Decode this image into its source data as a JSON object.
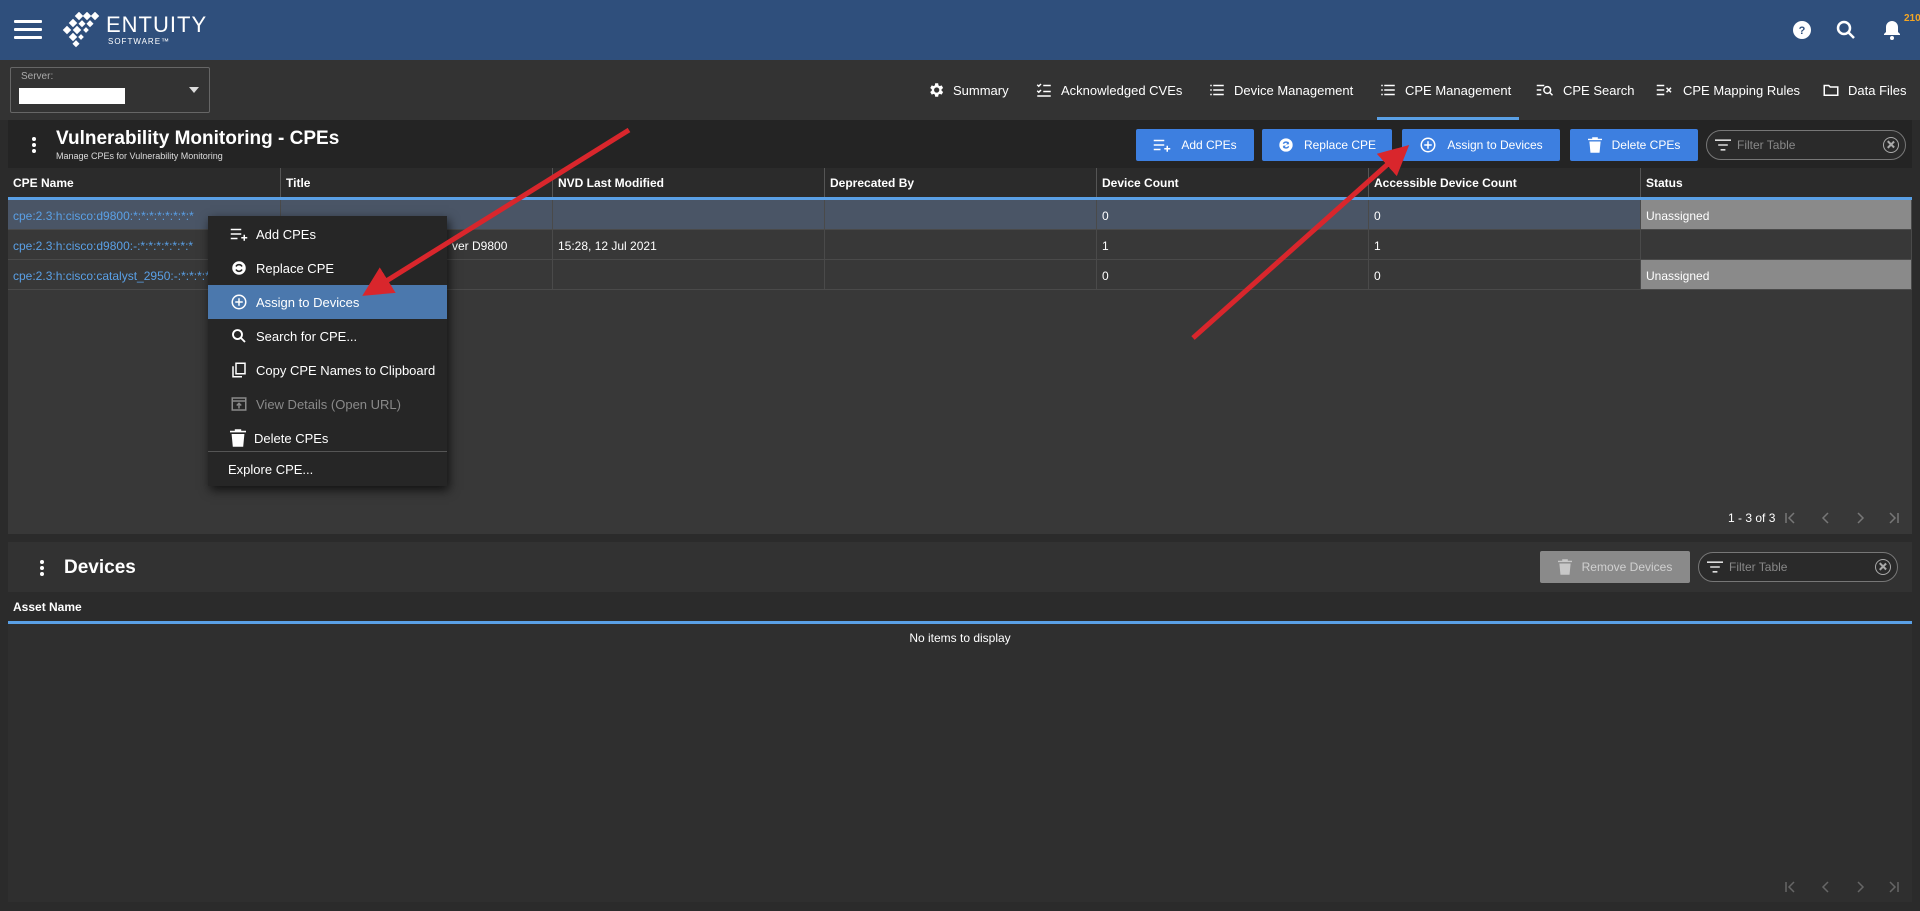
{
  "header": {
    "brand_name": "ENTUITY",
    "brand_sub": "SOFTWARE™",
    "notification_count": "210",
    "icons": [
      "menu-icon",
      "help-icon",
      "search-icon",
      "bell-icon"
    ]
  },
  "server": {
    "label": "Server:"
  },
  "nav": {
    "tabs": [
      {
        "label": "Summary",
        "icon": "gear-icon"
      },
      {
        "label": "Acknowledged CVEs",
        "icon": "checklist-icon"
      },
      {
        "label": "Device Management",
        "icon": "list-icon"
      },
      {
        "label": "CPE Management",
        "icon": "list-icon",
        "active": true
      },
      {
        "label": "CPE Search",
        "icon": "list-search-icon"
      },
      {
        "label": "CPE Mapping Rules",
        "icon": "mapping-icon"
      },
      {
        "label": "Data Files",
        "icon": "folder-icon"
      }
    ]
  },
  "cpe_panel": {
    "title": "Vulnerability Monitoring - CPEs",
    "subtitle": "Manage CPEs for Vulnerability Monitoring",
    "buttons": {
      "add": "Add CPEs",
      "replace": "Replace CPE",
      "assign": "Assign to Devices",
      "delete": "Delete CPEs"
    },
    "filter_placeholder": "Filter Table",
    "columns": [
      "CPE Name",
      "Title",
      "NVD Last Modified",
      "Deprecated By",
      "Device Count",
      "Accessible Device Count",
      "Status"
    ],
    "rows": [
      {
        "cpe": "cpe:2.3:h:cisco:d9800:*:*:*:*:*:*:*:*",
        "title": "",
        "nvd": "",
        "deprecated": "",
        "count": "0",
        "accessible": "0",
        "status": "Unassigned"
      },
      {
        "cpe": "cpe:2.3:h:cisco:d9800:-:*:*:*:*:*:*:*",
        "title": "ver D9800",
        "nvd": "15:28, 12 Jul 2021",
        "deprecated": "",
        "count": "1",
        "accessible": "1",
        "status": ""
      },
      {
        "cpe": "cpe:2.3:h:cisco:catalyst_2950:-:*:*:*:*",
        "title": "",
        "nvd": "",
        "deprecated": "",
        "count": "0",
        "accessible": "0",
        "status": "Unassigned"
      }
    ],
    "pagination": "1 - 3 of 3"
  },
  "context_menu": {
    "items": [
      {
        "label": "Add CPEs",
        "icon": "add-list-icon"
      },
      {
        "label": "Replace CPE",
        "icon": "replace-icon"
      },
      {
        "label": "Assign to Devices",
        "icon": "add-circle-icon",
        "highlighted": true
      },
      {
        "label": "Search for CPE...",
        "icon": "search-icon"
      },
      {
        "label": "Copy CPE Names to Clipboard",
        "icon": "copy-icon"
      },
      {
        "label": "View Details (Open URL)",
        "icon": "open-url-icon",
        "disabled": true
      },
      {
        "label": "Delete CPEs",
        "icon": "trash-icon"
      },
      {
        "label": "Explore CPE...",
        "icon": ""
      }
    ]
  },
  "devices_panel": {
    "title": "Devices",
    "remove_button": "Remove Devices",
    "filter_placeholder": "Filter Table",
    "column": "Asset Name",
    "empty_text": "No items to display"
  },
  "colors": {
    "header_bg": "#2f4f7c",
    "accent": "#5aa0e6",
    "button": "#3d7fe0",
    "menu_highlight": "#4b78ad",
    "annotation_arrow": "#d9262c"
  }
}
